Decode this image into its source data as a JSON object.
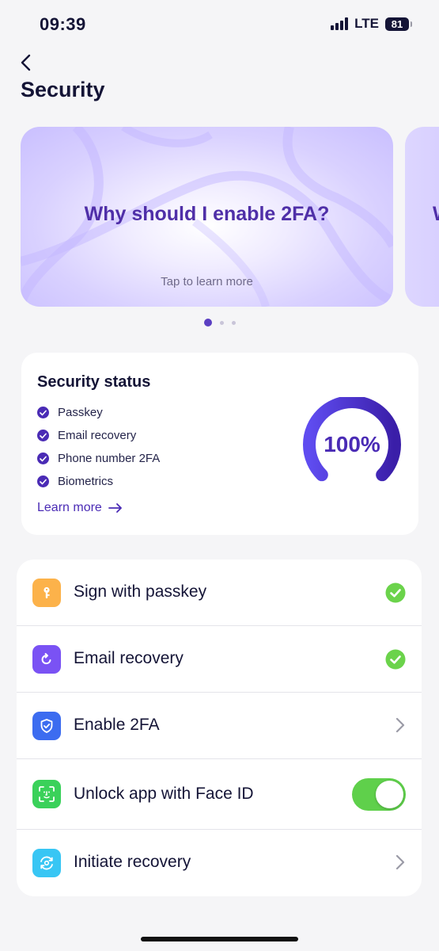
{
  "status_bar": {
    "time": "09:39",
    "network": "LTE",
    "battery": "81"
  },
  "header": {
    "back_icon": "chevron-left-icon",
    "title": "Security"
  },
  "carousel": {
    "cards": [
      {
        "title": "Why should I enable 2FA?",
        "subtitle": "Tap to learn more"
      }
    ],
    "next_card_peek": "W",
    "page_count": 3,
    "active_page": 1
  },
  "security_status": {
    "title": "Security status",
    "items": [
      "Passkey",
      "Email recovery",
      "Phone number 2FA",
      "Biometrics"
    ],
    "learn_more": "Learn more",
    "percent_label": "100%",
    "percent_value": 100
  },
  "settings": {
    "rows": [
      {
        "label": "Sign with passkey",
        "icon": "key-icon",
        "icon_color": "#fcb24a",
        "trailing": "check"
      },
      {
        "label": "Email recovery",
        "icon": "refresh-icon",
        "icon_color": "#7a52f4",
        "trailing": "check"
      },
      {
        "label": "Enable 2FA",
        "icon": "shield-check-icon",
        "icon_color": "#3c6cf0",
        "trailing": "chevron"
      },
      {
        "label": "Unlock app with Face ID",
        "icon": "face-id-icon",
        "icon_color": "#3ad15a",
        "trailing": "toggle",
        "toggle_on": true
      },
      {
        "label": "Initiate recovery",
        "icon": "recovery-icon",
        "icon_color": "#38c6f4",
        "trailing": "chevron"
      }
    ]
  },
  "colors": {
    "accent": "#4a2bb5",
    "success": "#6bd34b",
    "background": "#f5f5f7"
  }
}
